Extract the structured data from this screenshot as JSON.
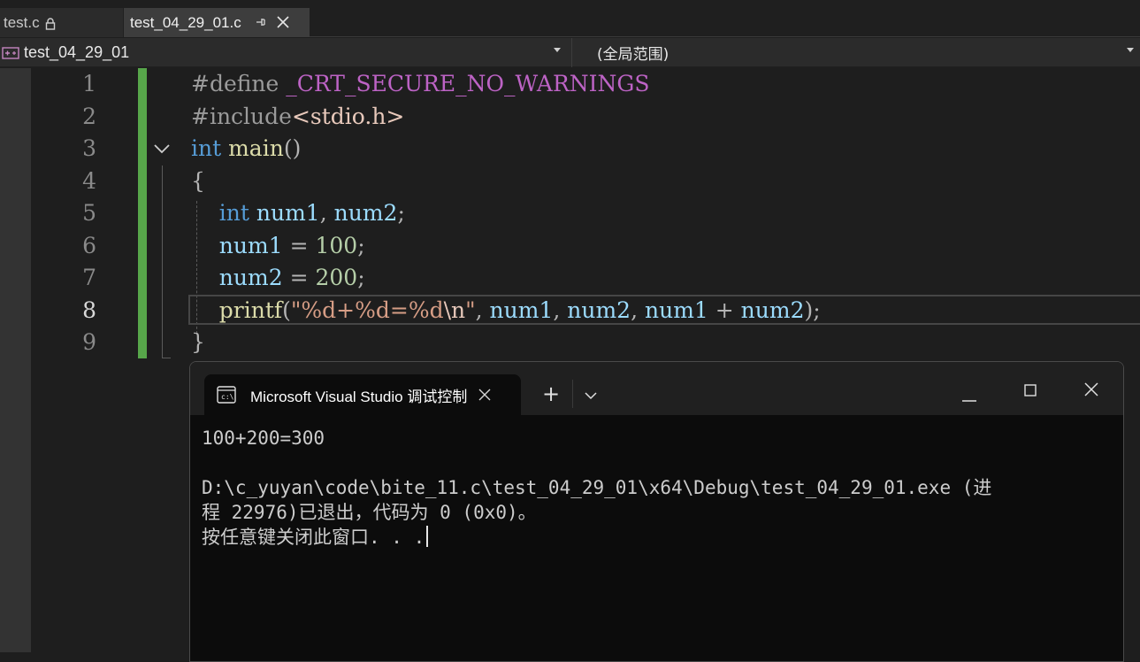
{
  "tabs": [
    {
      "label": "test.c",
      "locked": true,
      "active": false
    },
    {
      "label": "test_04_29_01.c",
      "active": true
    }
  ],
  "navbar": {
    "project": "test_04_29_01",
    "scope": "(全局范围)"
  },
  "editor": {
    "current_line": 8,
    "line_numbers": [
      "1",
      "2",
      "3",
      "4",
      "5",
      "6",
      "7",
      "8",
      "9"
    ],
    "lines": [
      [
        {
          "t": "pre",
          "v": "#define "
        },
        {
          "t": "macro",
          "v": "_CRT_SECURE_NO_WARNINGS"
        }
      ],
      [
        {
          "t": "pre",
          "v": "#include"
        },
        {
          "t": "hdr",
          "v": "<stdio.h>"
        }
      ],
      [
        {
          "t": "kw",
          "v": "int "
        },
        {
          "t": "fn",
          "v": "main"
        },
        {
          "t": "punc",
          "v": "()"
        }
      ],
      [
        {
          "t": "punc",
          "v": "{"
        }
      ],
      [
        {
          "t": "punc",
          "v": "    "
        },
        {
          "t": "kw",
          "v": "int "
        },
        {
          "t": "var",
          "v": "num1"
        },
        {
          "t": "punc",
          "v": ", "
        },
        {
          "t": "var",
          "v": "num2"
        },
        {
          "t": "punc",
          "v": ";"
        }
      ],
      [
        {
          "t": "punc",
          "v": "    "
        },
        {
          "t": "var",
          "v": "num1"
        },
        {
          "t": "punc",
          "v": " = "
        },
        {
          "t": "num",
          "v": "100"
        },
        {
          "t": "punc",
          "v": ";"
        }
      ],
      [
        {
          "t": "punc",
          "v": "    "
        },
        {
          "t": "var",
          "v": "num2"
        },
        {
          "t": "punc",
          "v": " = "
        },
        {
          "t": "num",
          "v": "200"
        },
        {
          "t": "punc",
          "v": ";"
        }
      ],
      [
        {
          "t": "punc",
          "v": "    "
        },
        {
          "t": "fn",
          "v": "printf"
        },
        {
          "t": "punc",
          "v": "("
        },
        {
          "t": "strc",
          "v": "\"%d+%d=%d"
        },
        {
          "t": "esc",
          "v": "\\n"
        },
        {
          "t": "strc",
          "v": "\""
        },
        {
          "t": "punc",
          "v": ", "
        },
        {
          "t": "var",
          "v": "num1"
        },
        {
          "t": "punc",
          "v": ", "
        },
        {
          "t": "var",
          "v": "num2"
        },
        {
          "t": "punc",
          "v": ", "
        },
        {
          "t": "var",
          "v": "num1"
        },
        {
          "t": "punc",
          "v": " + "
        },
        {
          "t": "var",
          "v": "num2"
        },
        {
          "t": "punc",
          "v": ");"
        }
      ],
      [
        {
          "t": "punc",
          "v": "}"
        }
      ]
    ]
  },
  "console": {
    "tab_title": "Microsoft Visual Studio 调试控制台",
    "new_tab_label": "+",
    "minimize_label": "—",
    "output": [
      "100+200=300",
      "",
      "D:\\c_yuyan\\code\\bite_11.c\\test_04_29_01\\x64\\Debug\\test_04_29_01.exe (进",
      "程 22976)已退出，代码为 0 (0x0)。",
      "按任意键关闭此窗口. . ."
    ]
  },
  "colors": {
    "change_bar": "#57a64a",
    "keyword": "#569cd6",
    "function": "#dcdcaa",
    "variable": "#9cdcfe",
    "number": "#b5cea8",
    "macro": "#bd63c5"
  }
}
